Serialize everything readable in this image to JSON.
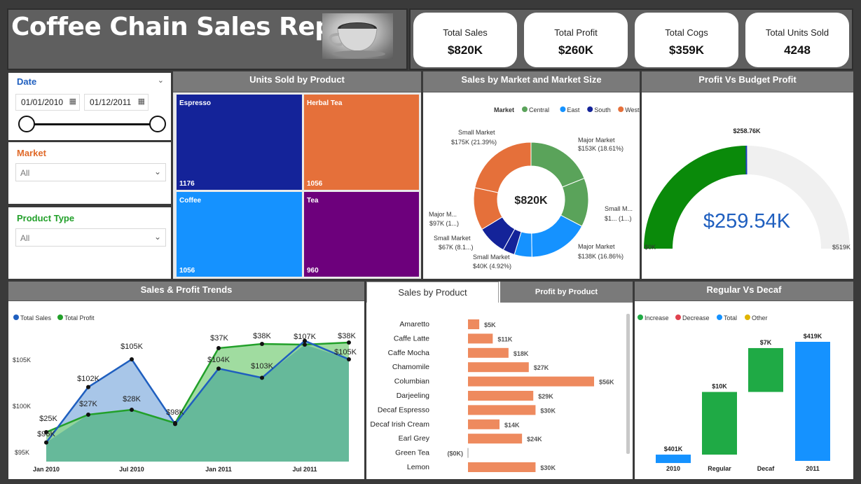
{
  "header": {
    "title": "Coffee Chain Sales Report",
    "image_alt": "coffee-cup-photo"
  },
  "kpis": [
    {
      "label": "Total Sales",
      "value": "$820K"
    },
    {
      "label": "Total Profit",
      "value": "$260K"
    },
    {
      "label": "Total Cogs",
      "value": "$359K"
    },
    {
      "label": "Total Units Sold",
      "value": "4248"
    }
  ],
  "slicers": {
    "date": {
      "title": "Date",
      "start": "01/01/2010",
      "end": "01/12/2011"
    },
    "market": {
      "title": "Market",
      "selected": "All"
    },
    "product_type": {
      "title": "Product Type",
      "selected": "All"
    }
  },
  "colors": {
    "accent_blue": "#1f5fbf",
    "market_orange": "#e06a2a",
    "product_green": "#22a02a"
  },
  "treemap": {
    "title": "Units Sold by Product",
    "chart_data": {
      "type": "treemap",
      "items": [
        {
          "name": "Espresso",
          "value": 1176,
          "label": "1176",
          "color": "#142399"
        },
        {
          "name": "Herbal Tea",
          "value": 1056,
          "label": "1056",
          "color": "#e5703a"
        },
        {
          "name": "Coffee",
          "value": 1056,
          "label": "1056",
          "color": "#1592ff"
        },
        {
          "name": "Tea",
          "value": 960,
          "label": "960",
          "color": "#6d007c"
        }
      ]
    }
  },
  "donut": {
    "title": "Sales by Market and Market Size",
    "center": "$820K",
    "legend_title": "Market",
    "legend": [
      {
        "name": "Central",
        "color": "#5aa35a"
      },
      {
        "name": "East",
        "color": "#1592ff"
      },
      {
        "name": "South",
        "color": "#142399"
      },
      {
        "name": "West",
        "color": "#e5703a"
      }
    ],
    "labels": [
      {
        "l1": "Major Market",
        "l2": "$153K (18.61%)"
      },
      {
        "l1": "Small M...",
        "l2": "$1... (1...)"
      },
      {
        "l1": "Major Market",
        "l2": "$138K (16.86%)"
      },
      {
        "l1": "Small Market",
        "l2": "$40K (4.92%)"
      },
      {
        "l1": "Small Market",
        "l2": "$67K (8.1...)"
      },
      {
        "l1": "Major M...",
        "l2": "$97K (1...)"
      },
      {
        "l1": "Small Market",
        "l2": "$175K (21.39%)"
      }
    ],
    "chart_data": {
      "type": "pie",
      "slices": [
        {
          "market": "Central",
          "size": "Major Market",
          "value": 153,
          "pct": 18.61,
          "color": "#5aa35a"
        },
        {
          "market": "Central",
          "size": "Small Market",
          "value": 111,
          "pct": 13.5,
          "color": "#5aa35a"
        },
        {
          "market": "East",
          "size": "Major Market",
          "value": 138,
          "pct": 16.86,
          "color": "#1592ff"
        },
        {
          "market": "East",
          "size": "Small Market",
          "value": 40,
          "pct": 4.92,
          "color": "#1592ff"
        },
        {
          "market": "South",
          "size": "Small Market",
          "value": 27,
          "pct": 3.3,
          "color": "#142399"
        },
        {
          "market": "South",
          "size": "Major Market",
          "value": 67,
          "pct": 8.1,
          "color": "#142399"
        },
        {
          "market": "West",
          "size": "Major Market",
          "value": 97,
          "pct": 11.8,
          "color": "#e5703a"
        },
        {
          "market": "West",
          "size": "Small Market",
          "value": 175,
          "pct": 21.39,
          "color": "#e5703a"
        }
      ]
    }
  },
  "gauge": {
    "title": "Profit Vs Budget Profit",
    "value_text": "$259.54K",
    "target_text": "$258.76K",
    "min_text": "$0K",
    "max_text": "$519K",
    "chart_data": {
      "type": "gauge",
      "value": 259.54,
      "target": 258.76,
      "min": 0,
      "max": 519
    }
  },
  "trends": {
    "title": "Sales & Profit Trends",
    "legend": [
      {
        "name": "Total Sales",
        "color": "#1f5fbf"
      },
      {
        "name": "Total Profit",
        "color": "#22a02a"
      }
    ],
    "y_ticks": [
      "$105K",
      "$100K",
      "$95K"
    ],
    "x_ticks": [
      "Jan 2010",
      "Jul 2010",
      "Jan 2011",
      "Jul 2011"
    ],
    "sales_labels": [
      "$96K",
      "$102K",
      "$105K",
      "$98K",
      "$104K",
      "$103K",
      "$107K",
      "$105K"
    ],
    "profit_labels": [
      "$25K",
      "$27K",
      "$28K",
      "$37K",
      "$38K",
      "$38K"
    ],
    "chart_data": {
      "type": "area",
      "x": [
        "Jan 2010",
        "Apr 2010",
        "Jul 2010",
        "Oct 2010",
        "Jan 2011",
        "Apr 2011",
        "Jul 2011",
        "Oct 2011"
      ],
      "series": [
        {
          "name": "Total Sales",
          "values": [
            96,
            102,
            105,
            98,
            104,
            103,
            107,
            105
          ]
        },
        {
          "name": "Total Profit",
          "values": [
            25,
            27,
            28,
            25,
            37,
            38,
            38,
            38
          ]
        }
      ]
    }
  },
  "product_bar": {
    "tabs": [
      "Sales by Product",
      "Profit by Product"
    ],
    "chart_data": {
      "type": "bar",
      "categories": [
        "Amaretto",
        "Caffe Latte",
        "Caffe Mocha",
        "Chamomile",
        "Columbian",
        "Darjeeling",
        "Decaf Espresso",
        "Decaf Irish Cream",
        "Earl Grey",
        "Green Tea",
        "Lemon"
      ],
      "values": [
        5,
        11,
        18,
        27,
        56,
        29,
        30,
        14,
        24,
        0,
        30
      ],
      "labels": [
        "$5K",
        "$11K",
        "$18K",
        "$27K",
        "$56K",
        "$29K",
        "$30K",
        "$14K",
        "$24K",
        "($0K)",
        "$30K"
      ],
      "color": "#ee8a5e"
    }
  },
  "waterfall": {
    "title": "Regular Vs Decaf",
    "legend": [
      {
        "name": "Increase",
        "color": "#1faa45"
      },
      {
        "name": "Decrease",
        "color": "#e0424e"
      },
      {
        "name": "Total",
        "color": "#1592ff"
      },
      {
        "name": "Other",
        "color": "#e0b400"
      }
    ],
    "chart_data": {
      "type": "bar",
      "categories": [
        "2010",
        "Regular",
        "Decaf",
        "2011"
      ],
      "values": [
        401,
        10,
        7,
        419
      ],
      "labels": [
        "$401K",
        "$10K",
        "$7K",
        "$419K"
      ],
      "kinds": [
        "total",
        "increase",
        "increase",
        "total"
      ]
    }
  }
}
